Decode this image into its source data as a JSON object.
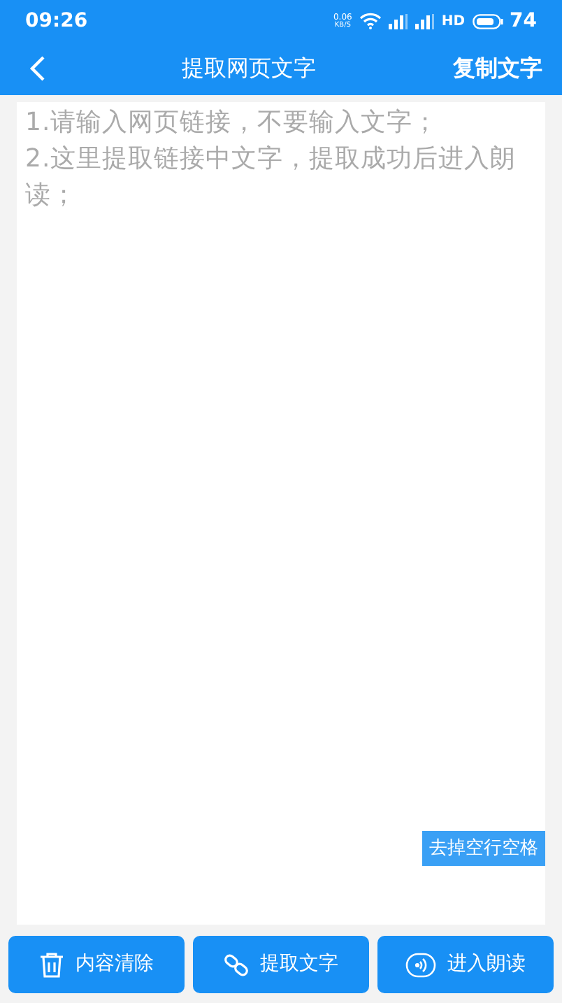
{
  "status_bar": {
    "time": "09:26",
    "net_speed": [
      "0.06",
      "KB/S"
    ],
    "network": "HD",
    "battery": "74"
  },
  "header": {
    "title": "提取网页文字",
    "action": "复制文字"
  },
  "editor": {
    "placeholder": "1.请输入网页链接，不要输入文字；\n2.这里提取链接中文字，提取成功后进入朗读；",
    "tool_button": "去掉空行空格"
  },
  "buttons": [
    {
      "kind": "clear",
      "label": "内容清除"
    },
    {
      "kind": "extract",
      "label": "提取文字"
    },
    {
      "kind": "read",
      "label": "进入朗读"
    }
  ]
}
